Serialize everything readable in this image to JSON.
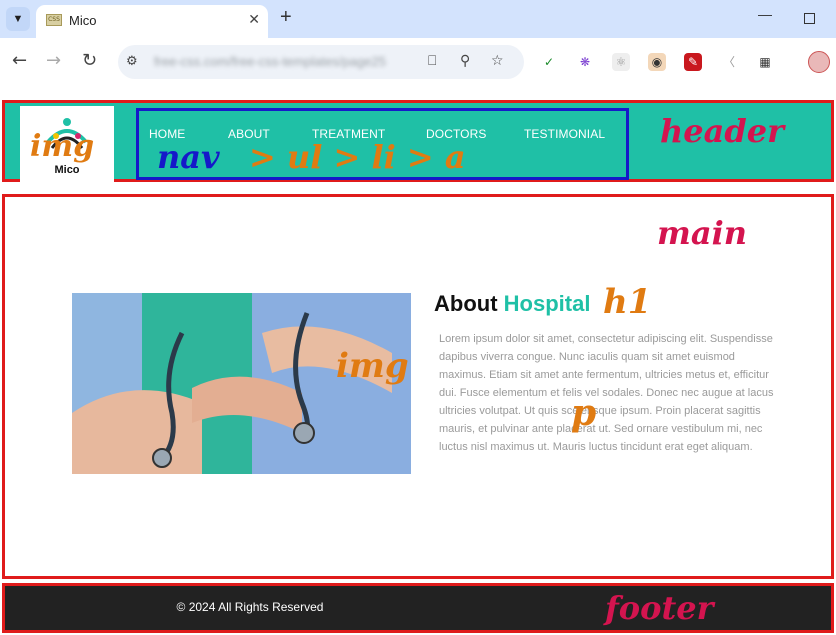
{
  "browser": {
    "tab_title": "Mico",
    "tab_favicon_text": "CSS",
    "url": "free-css.com/free-css-templates/page25",
    "tab_list_icon": "chevron-down-icon",
    "new_tab_icon": "plus-icon",
    "close_tab_icon": "close-icon"
  },
  "header": {
    "logo_text": "Mico",
    "nav": [
      "HOME",
      "ABOUT",
      "TREATMENT",
      "DOCTORS",
      "TESTIMONIAL"
    ]
  },
  "main": {
    "title_part1": "About",
    "title_part2": "Hospital",
    "paragraph": "Lorem ipsum dolor sit amet, consectetur adipiscing elit. Suspendisse dapibus viverra congue. Nunc iaculis quam sit amet euismod maximus. Etiam sit amet ante fermentum, ultricies metus et, efficitur dui. Fusce elementum et felis vel sodales. Donec nec augue at lacus ultricies volutpat. Ut quis scelerisque ipsum. Proin placerat sagittis mauris, et pulvinar ante placerat ut. Sed ornare vestibulum mi, nec luctus nisl maximus ut. Mauris luctus tincidunt erat eget aliquam."
  },
  "footer": {
    "text": "© 2024 All Rights Reserved"
  },
  "annotations": {
    "header": "header",
    "nav": "nav",
    "nav_chain": "> ul > li > a",
    "logo_img": "img",
    "main": "main",
    "hero_img": "img",
    "h1": "h1",
    "p": "p",
    "footer": "footer"
  },
  "colors": {
    "header_bg": "#1fc0a6",
    "accent": "#1fc0a6",
    "outline_red": "#e01b1b",
    "outline_blue": "#1519c9",
    "annotation_orange": "#e07b12",
    "annotation_crimson": "#d4144f",
    "annotation_blue": "#1519c9",
    "footer_bg": "#222222"
  }
}
